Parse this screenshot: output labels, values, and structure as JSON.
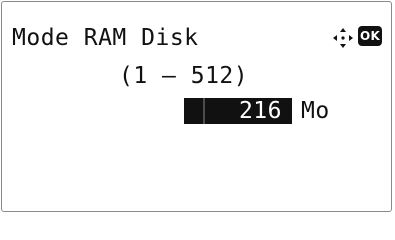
{
  "screen": {
    "title": "Mode RAM Disk",
    "range": "(1 – 512)",
    "value": "216",
    "unit": "Mo"
  },
  "icons": {
    "navigate": "four-way-navigation-icon",
    "ok": "OK"
  },
  "colors": {
    "text": "#111111",
    "highlight": "#111111",
    "highlight_text": "#ffffff",
    "background": "#ffffff"
  }
}
